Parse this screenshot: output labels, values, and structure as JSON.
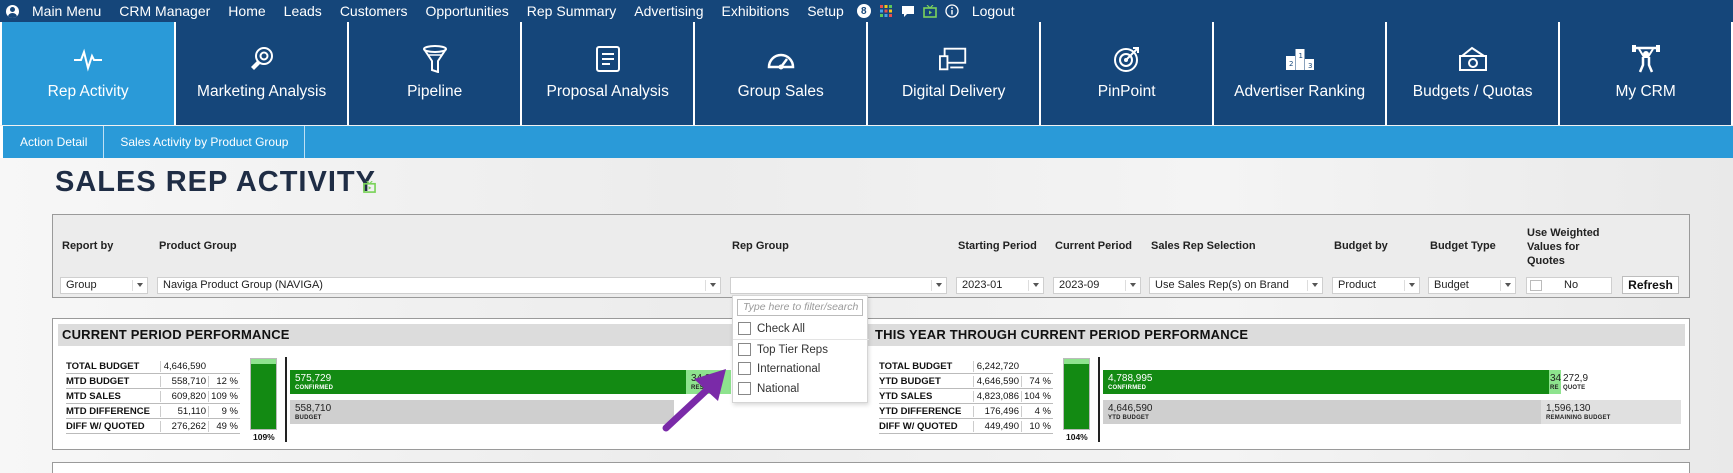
{
  "menu": {
    "items": [
      "Main Menu",
      "CRM Manager",
      "Home",
      "Leads",
      "Customers",
      "Opportunities",
      "Rep Summary",
      "Advertising",
      "Exhibitions",
      "Setup"
    ],
    "badge": "8",
    "logout": "Logout",
    "icons": [
      "user-icon",
      "badge-icon",
      "grid-icon",
      "chat-icon",
      "tv-icon",
      "info-icon"
    ]
  },
  "tiles": [
    {
      "label": "Rep Activity",
      "icon": "activity-icon",
      "active": true
    },
    {
      "label": "Marketing Analysis",
      "icon": "target-hand-icon"
    },
    {
      "label": "Pipeline",
      "icon": "funnel-icon"
    },
    {
      "label": "Proposal Analysis",
      "icon": "document-icon"
    },
    {
      "label": "Group Sales",
      "icon": "gauge-icon"
    },
    {
      "label": "Digital Delivery",
      "icon": "devices-icon"
    },
    {
      "label": "PinPoint",
      "icon": "bullseye-icon"
    },
    {
      "label": "Advertiser Ranking",
      "icon": "podium-icon"
    },
    {
      "label": "Budgets / Quotas",
      "icon": "money-icon"
    },
    {
      "label": "My CRM",
      "icon": "weightlifter-icon"
    }
  ],
  "subtabs": [
    "Action Detail",
    "Sales Activity by Product Group"
  ],
  "page_title": "SALES REP ACTIVITY",
  "filters": {
    "report_by": {
      "label": "Report by",
      "value": "Group"
    },
    "product_group": {
      "label": "Product Group",
      "value": "Naviga Product Group (NAVIGA)"
    },
    "rep_group": {
      "label": "Rep Group",
      "value": ""
    },
    "starting_period": {
      "label": "Starting Period",
      "value": "2023-01"
    },
    "current_period": {
      "label": "Current Period",
      "value": "2023-09"
    },
    "sales_rep_selection": {
      "label": "Sales Rep Selection",
      "value": "Use Sales Rep(s) on Brand"
    },
    "budget_by": {
      "label": "Budget by",
      "value": "Product"
    },
    "budget_type": {
      "label": "Budget Type",
      "value": "Budget"
    },
    "weighted": {
      "label_1": "Use Weighted",
      "label_2": "Values for",
      "label_3": "Quotes",
      "value": "No"
    },
    "refresh": "Refresh"
  },
  "rep_group_dropdown": {
    "placeholder": "Type here to filter/search",
    "check_all": "Check All",
    "options": [
      "Top Tier Reps",
      "International",
      "National"
    ]
  },
  "current_period": {
    "title": "CURRENT PERIOD PERFORMANCE",
    "rows": [
      {
        "label": "TOTAL BUDGET",
        "value": "4,646,590",
        "pct": ""
      },
      {
        "label": "MTD BUDGET",
        "value": "558,710",
        "pct": "12 %"
      },
      {
        "label": "MTD SALES",
        "value": "609,820",
        "pct": "109 %"
      },
      {
        "label": "MTD DIFFERENCE",
        "value": "51,110",
        "pct": "9 %"
      },
      {
        "label": "DIFF W/ QUOTED",
        "value": "276,262",
        "pct": "49 %"
      }
    ],
    "gauge_pct": "109%",
    "gauge_fill": 1.0,
    "confirmed_value": "575,729",
    "confirmed_label": "CONFIRMED",
    "partial_value": "34,0",
    "partial_label": "RES",
    "budget_value": "558,710",
    "budget_label": "BUDGET"
  },
  "ytd_period": {
    "title": "THIS YEAR THROUGH CURRENT PERIOD PERFORMANCE",
    "rows": [
      {
        "label": "TOTAL BUDGET",
        "value": "6,242,720",
        "pct": ""
      },
      {
        "label": "YTD BUDGET",
        "value": "4,646,590",
        "pct": "74 %"
      },
      {
        "label": "YTD SALES",
        "value": "4,823,086",
        "pct": "104 %"
      },
      {
        "label": "YTD DIFFERENCE",
        "value": "176,496",
        "pct": "4 %"
      },
      {
        "label": "DIFF W/ QUOTED",
        "value": "449,490",
        "pct": "10 %"
      }
    ],
    "gauge_pct": "104%",
    "gauge_fill": 1.0,
    "confirmed_value": "4,788,995",
    "confirmed_label": "CONFIRMED",
    "partial_value": "34",
    "partial_label": "RE",
    "quoted_value": "272,9",
    "quoted_label": "QUOTE",
    "budget_value": "4,646,590",
    "budget_label": "YTD BUDGET",
    "remaining_value": "1,596,130",
    "remaining_label": "REMAINING BUDGET"
  }
}
